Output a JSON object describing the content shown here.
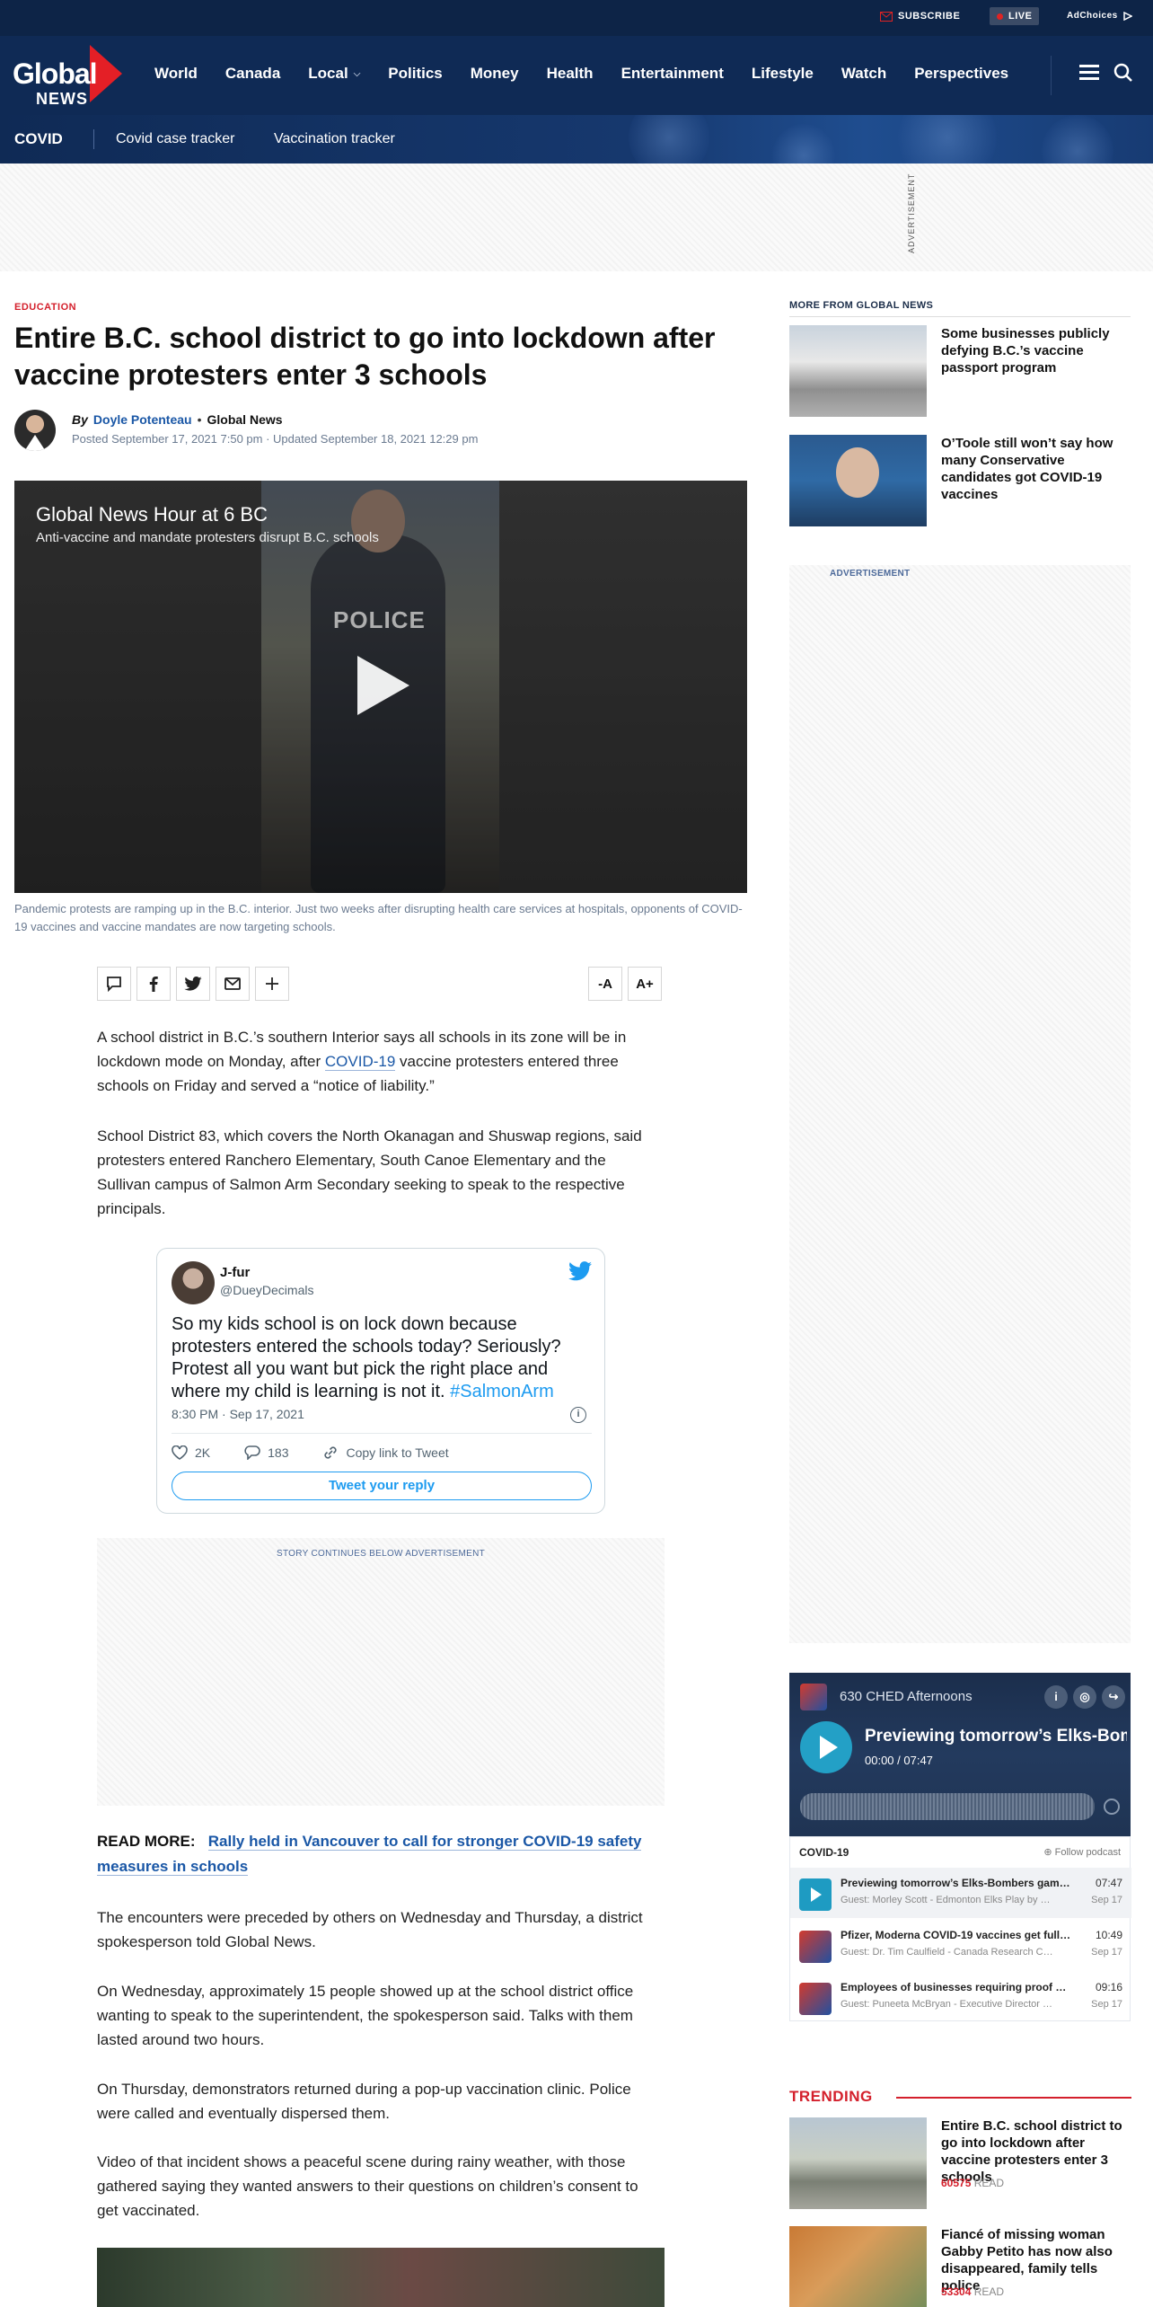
{
  "topbar": {
    "subscribe": "SUBSCRIBE",
    "live": "LIVE",
    "adchoices": "AdChoices"
  },
  "brand": {
    "line1": "Global",
    "line2": "NEWS"
  },
  "nav": [
    "World",
    "Canada",
    "Local",
    "Politics",
    "Money",
    "Health",
    "Entertainment",
    "Lifestyle",
    "Watch",
    "Perspectives"
  ],
  "covid_bar": {
    "label": "COVID",
    "links": [
      "Covid case tracker",
      "Vaccination tracker"
    ]
  },
  "top_ad": {
    "label": "ADVERTISEMENT"
  },
  "article": {
    "category": "EDUCATION",
    "headline": "Entire B.C. school district to go into lockdown after vaccine protesters enter 3 schools",
    "by": "By",
    "author": "Doyle Potenteau",
    "org": "Global News",
    "dates": "Posted September 17, 2021 7:50 pm · Updated September 18, 2021 12:29 pm",
    "video": {
      "title": "Global News Hour at 6 BC",
      "subtitle": "Anti-vaccine and mandate protesters disrupt B.C. schools",
      "police_text": "POLICE"
    },
    "caption": "Pandemic protests are ramping up in the B.C. interior. Just two weeks after disrupting health care services at hospitals, opponents of COVID-19 vaccines and vaccine mandates are now targeting schools.",
    "font_controls": [
      "-A",
      "A+"
    ],
    "p1_before": "A school district in B.C.’s southern Interior says all schools in its zone will be in lockdown mode on Monday, after ",
    "p1_link": "COVID-19",
    "p1_after": " vaccine protesters entered three schools on Friday and served a “notice of liability.”",
    "p2": "School District 83, which covers the North Okanagan and Shuswap regions, said protesters entered Ranchero Elementary, South Canoe Elementary and the Sullivan campus of Salmon Arm Secondary seeking to speak to the respective principals.",
    "tweet": {
      "name": "J-fur",
      "handle": "@DueyDecimals",
      "text": "So my kids school is on lock down because protesters entered the schools today? Seriously? Protest all you want but pick the right place and where my child is learning is not it. ",
      "hashtag": "#SalmonArm",
      "time": "8:30 PM · Sep 17, 2021",
      "likes": "2K",
      "replies": "183",
      "copy": "Copy link to Tweet",
      "reply_btn": "Tweet your reply"
    },
    "inline_ad": "STORY CONTINUES BELOW ADVERTISEMENT",
    "read_more_label": "READ MORE:",
    "read_more_link": "Rally held in Vancouver to call for stronger COVID-19 safety measures in schools",
    "p3": "The encounters were preceded by others on Wednesday and Thursday, a district spokesperson told Global News.",
    "p4": "On Wednesday, approximately 15 people showed up at the school district office wanting to speak to the superintendent, the spokesperson said. Talks with them lasted around two hours.",
    "p5": "On Thursday, demonstrators returned during a pop-up vaccination clinic. Police were called and eventually dispersed them.",
    "p6": "Video of that incident shows a peaceful scene during rainy weather, with those gathered saying they wanted answers to their questions on children’s consent to get vaccinated."
  },
  "sidebar": {
    "more_heading": "MORE FROM GLOBAL NEWS",
    "more": [
      {
        "title": "Some businesses publicly defying B.C.’s vaccine passport program"
      },
      {
        "title": "O’Toole still won’t say how many Conservative candidates got COVID-19 vaccines"
      }
    ],
    "ad_label": "ADVERTISEMENT",
    "podcast": {
      "show": "630 CHED Afternoons",
      "episode": "Previewing tomorrow’s Elks-Bombers",
      "time": "00:00 / 07:47",
      "list_heading": "COVID-19",
      "follow": "Follow podcast",
      "items": [
        {
          "title": "Previewing tomorrow’s Elks-Bombers gam…",
          "guest": "Guest: Morley Scott - Edmonton Elks Play by …",
          "dur": "07:47",
          "date": "Sep 17"
        },
        {
          "title": "Pfizer, Moderna COVID-19 vaccines get full…",
          "guest": "Guest: Dr. Tim Caulfield - Canada Research C…",
          "dur": "10:49",
          "date": "Sep 17"
        },
        {
          "title": "Employees of businesses requiring proof o…",
          "guest": "Guest: Puneeta McBryan - Executive Director …",
          "dur": "09:16",
          "date": "Sep 17"
        }
      ]
    },
    "trending_heading": "TRENDING",
    "trending": [
      {
        "title": "Entire B.C. school district to go into lockdown after vaccine protesters enter 3 schools",
        "count": "60575",
        "read": "READ"
      },
      {
        "title": "Fiancé of missing woman Gabby Petito has now also disappeared, family tells police",
        "count": "53304",
        "read": "READ"
      }
    ]
  }
}
